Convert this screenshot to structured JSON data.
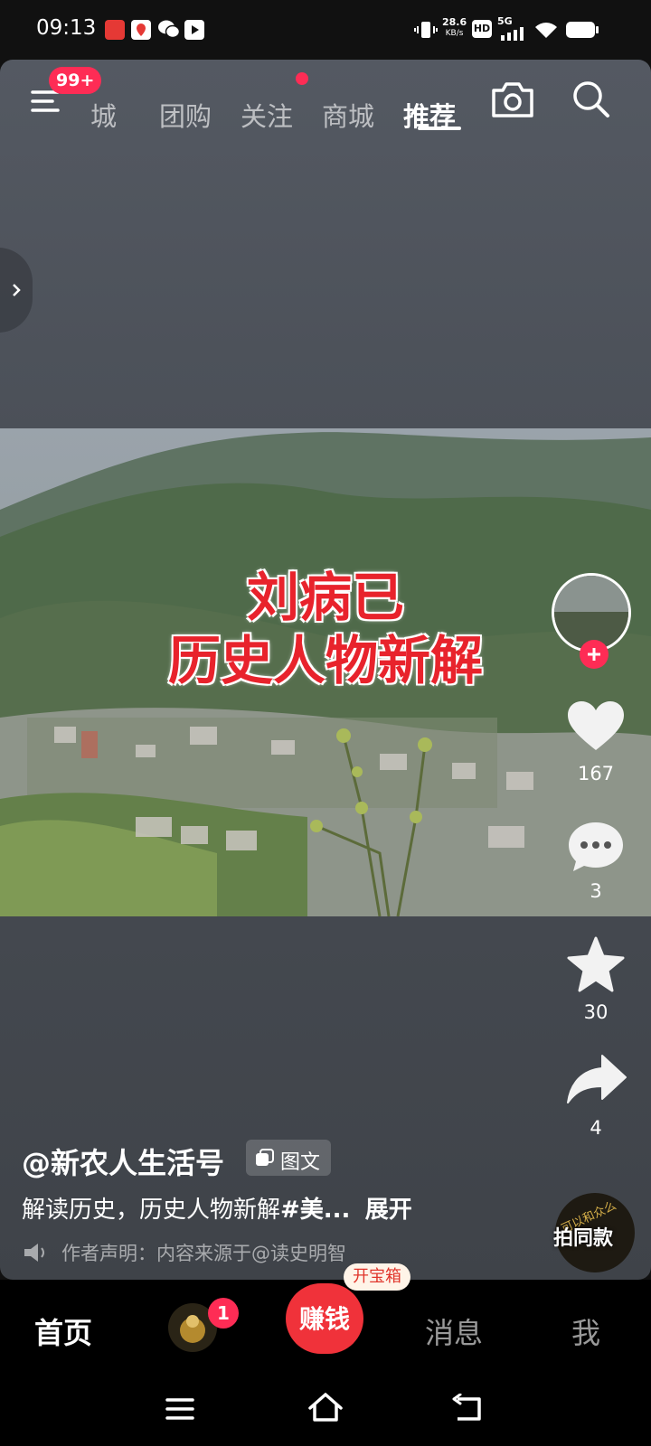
{
  "status_bar": {
    "time": "09:13",
    "net_speed": "28.6",
    "net_unit": "KB/s",
    "hd": "HD",
    "signal": "5G"
  },
  "top_nav": {
    "badge": "99+",
    "tabs": [
      "商城",
      "团购",
      "关注",
      "商城",
      "推荐"
    ],
    "partial_tab": "城",
    "active_index": 4,
    "follow_dot_color": "#fe2c55"
  },
  "video": {
    "overlay_title_line1": "刘病已",
    "overlay_title_line2": "历史人物新解"
  },
  "right_rail": {
    "likes": "167",
    "comments": "3",
    "favorites": "30",
    "shares": "4",
    "same_style_label": "拍同款",
    "disc_text": "可以和众么"
  },
  "post": {
    "author": "@新农人生活号",
    "type_badge": "图文",
    "description": "解读历史，历史人物新解",
    "hashtag": "#美...",
    "expand": "展开",
    "declaration": "作者声明：内容来源于@读史明智"
  },
  "bottom_tabs": {
    "home": "首页",
    "friend_badge": "1",
    "earn": "赚钱",
    "treasure_label": "开宝箱",
    "messages": "消息",
    "me": "我"
  },
  "colors": {
    "accent": "#fe2c55",
    "overlay_title": "#e8232c"
  }
}
